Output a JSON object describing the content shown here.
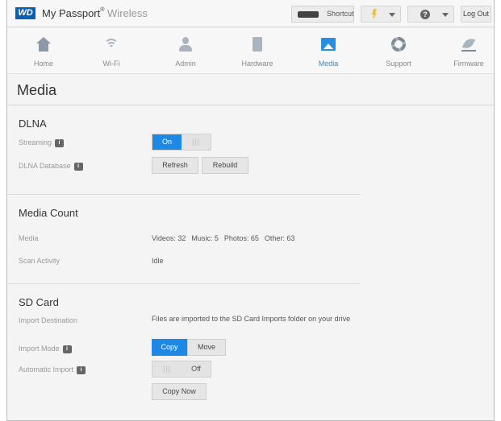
{
  "header": {
    "logo_text": "WD",
    "brand_name": "My Passport",
    "brand_reg": "®",
    "brand_suffix": "Wireless",
    "shortcut_label": "Shortcut",
    "help_glyph": "?",
    "logout_label": "Log Out"
  },
  "nav": {
    "items": [
      {
        "label": "Home",
        "icon": "home-icon"
      },
      {
        "label": "Wi-Fi",
        "icon": "wifi-icon"
      },
      {
        "label": "Admin",
        "icon": "admin-icon"
      },
      {
        "label": "Hardware",
        "icon": "hardware-icon"
      },
      {
        "label": "Media",
        "icon": "media-icon",
        "active": true
      },
      {
        "label": "Support",
        "icon": "support-icon"
      },
      {
        "label": "Firmware",
        "icon": "firmware-icon"
      }
    ]
  },
  "page": {
    "title": "Media"
  },
  "dlna": {
    "title": "DLNA",
    "streaming_label": "Streaming",
    "streaming_on": "On",
    "streaming_off_glyph": "|||",
    "database_label": "DLNA Database",
    "refresh_label": "Refresh",
    "rebuild_label": "Rebuild"
  },
  "media_count": {
    "title": "Media Count",
    "media_label": "Media",
    "videos": "Videos: 32",
    "music": "Music: 5",
    "photos": "Photos: 65",
    "other": "Other: 63",
    "scan_label": "Scan Activity",
    "scan_value": "Idle"
  },
  "sd_card": {
    "title": "SD Card",
    "destination_label": "Import Destination",
    "destination_value": "Files are imported to the SD Card Imports folder on your drive",
    "mode_label": "Import Mode",
    "mode_copy": "Copy",
    "mode_move": "Move",
    "auto_label": "Automatic Import",
    "auto_bars_glyph": "|||",
    "auto_off": "Off",
    "copy_now_label": "Copy Now"
  },
  "colors": {
    "accent": "#1e88e5",
    "logo_bg": "#0b5fb0",
    "alert": "#f2c12e"
  }
}
